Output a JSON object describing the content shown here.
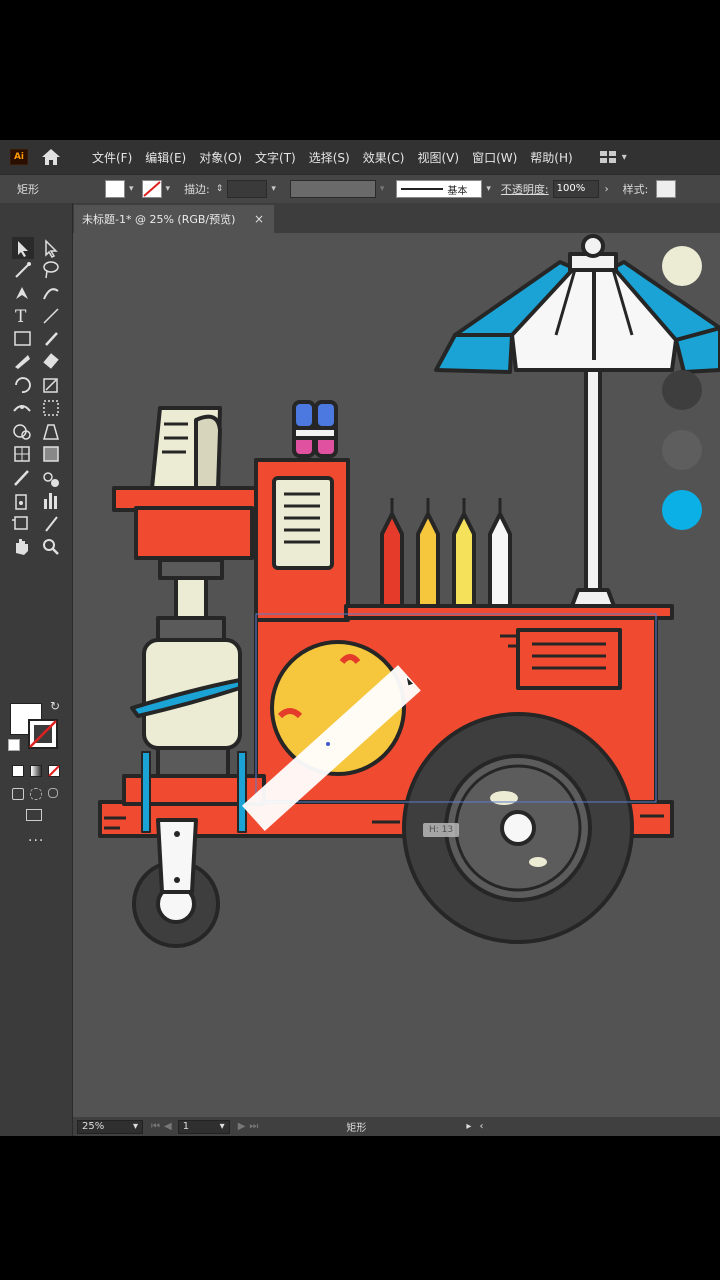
{
  "app": {
    "logo_text": "Ai",
    "menu": [
      "文件(F)",
      "编辑(E)",
      "对象(O)",
      "文字(T)",
      "选择(S)",
      "效果(C)",
      "视图(V)",
      "窗口(W)",
      "帮助(H)"
    ]
  },
  "control_bar": {
    "object_type": "矩形",
    "stroke_label": "描边:",
    "stroke_style": "基本",
    "opacity_label": "不透明度:",
    "opacity_value": "100%",
    "style_label": "样式:"
  },
  "document_tab": {
    "title": "未标题-1* @ 25% (RGB/预览)",
    "close": "×"
  },
  "canvas": {
    "tooltip": "H: 13"
  },
  "status_bar": {
    "zoom": "25%",
    "artboard": "1",
    "tool_name": "矩形"
  },
  "colors": {
    "cart_red": "#f04a30",
    "umbrella_blue": "#1aa3d4",
    "outline": "#262626",
    "cream": "#ecebd3",
    "yellow": "#f6c63c",
    "swatch_cyan": "#0ab0e6"
  }
}
